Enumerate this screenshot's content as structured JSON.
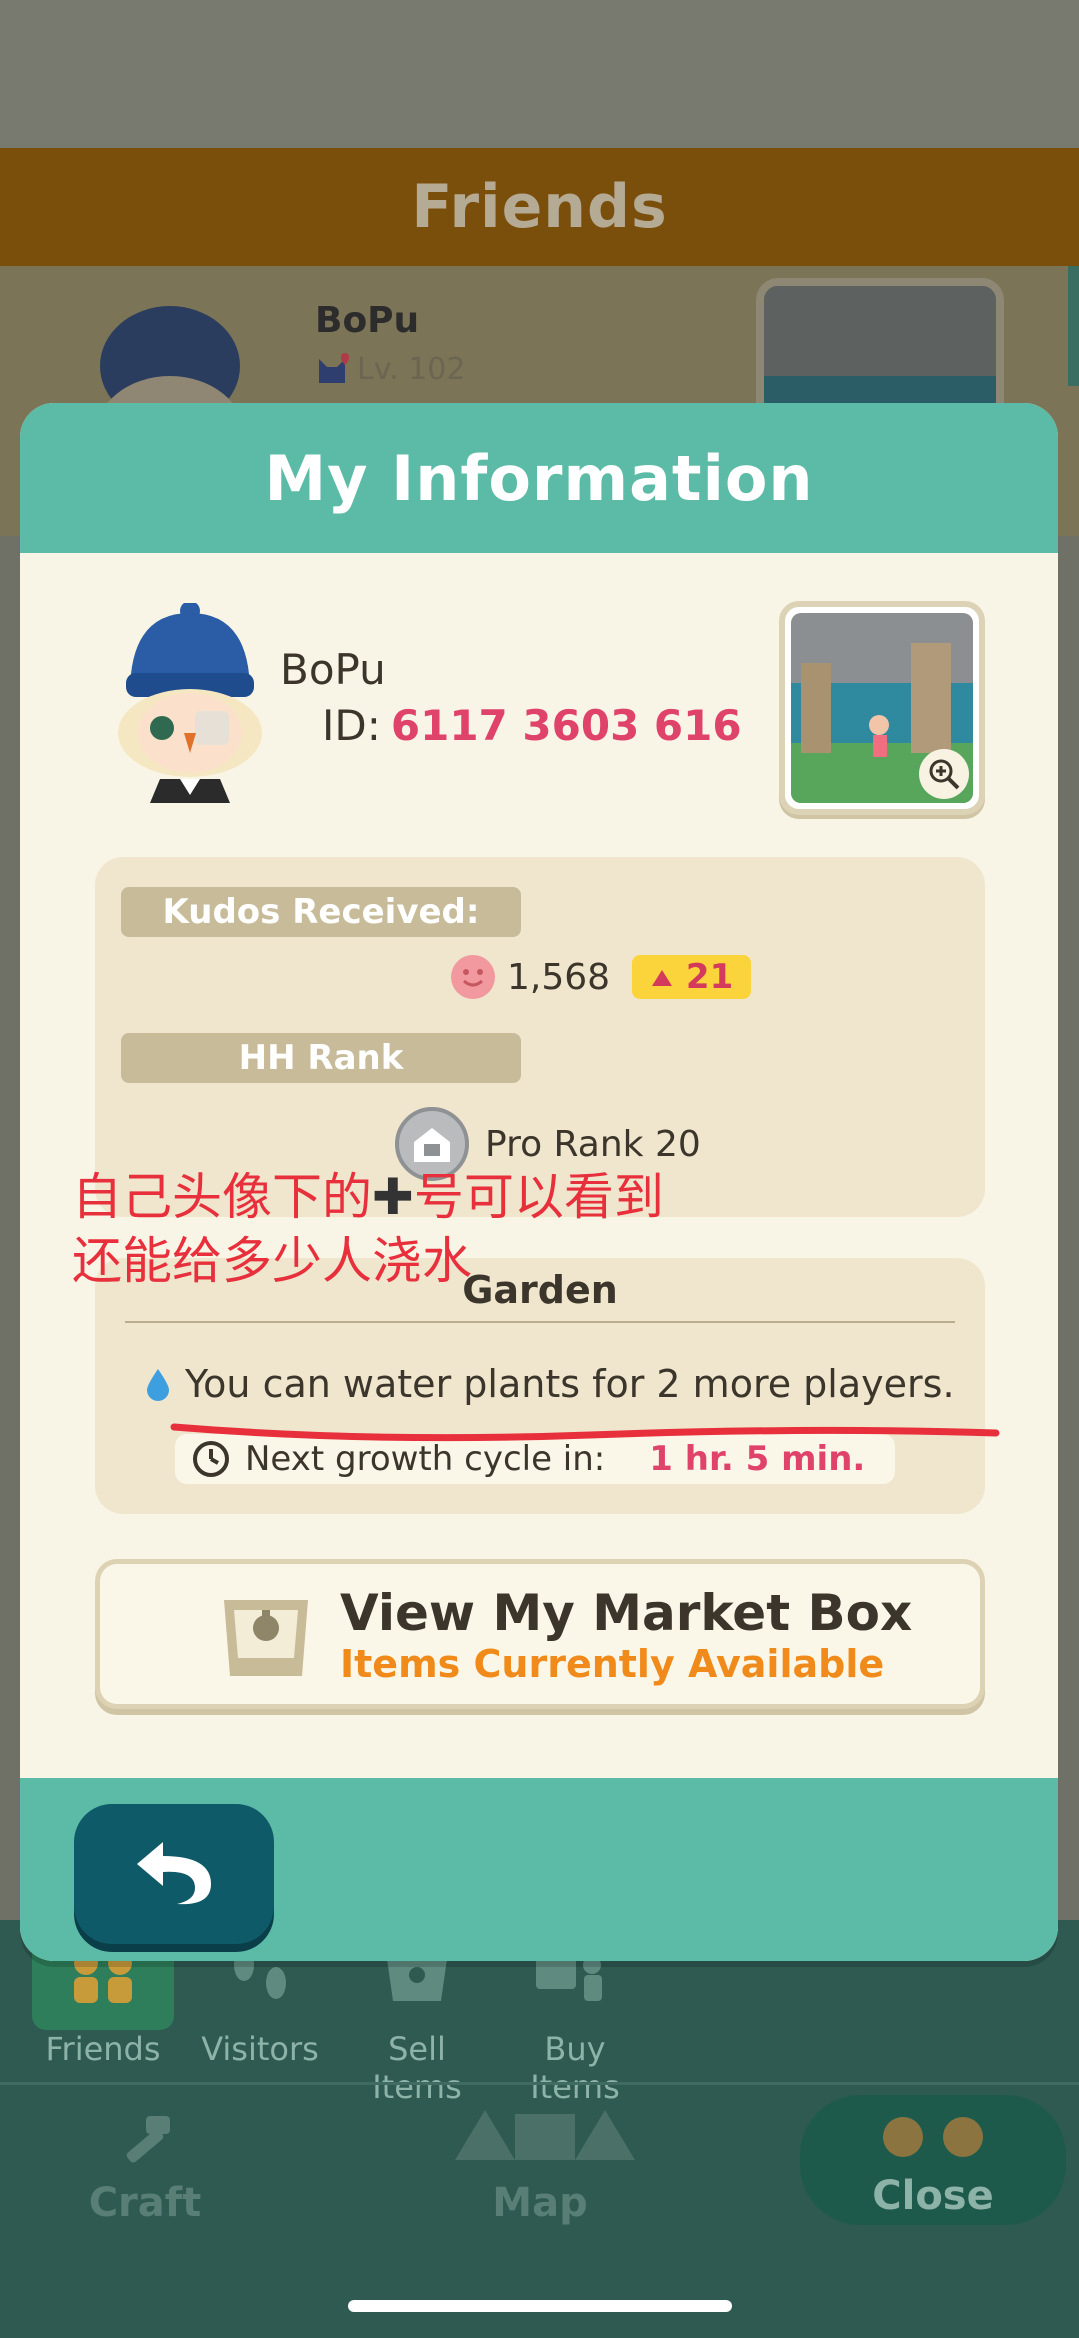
{
  "background_screen": {
    "title": "Friends",
    "friend": {
      "name": "BoPu",
      "level": "Lv. 102"
    },
    "tabs": [
      {
        "label": "Friends",
        "icon": "friends-icon"
      },
      {
        "label": "Visitors",
        "icon": "footprints-icon"
      },
      {
        "label": "Sell Items",
        "icon": "market-box-icon"
      },
      {
        "label": "Buy Items",
        "icon": "shopping-icon"
      }
    ],
    "nav": {
      "craft": "Craft",
      "map": "Map",
      "close": "Close"
    }
  },
  "modal": {
    "title": "My Information",
    "profile": {
      "name": "BoPu",
      "id_label": "ID:",
      "id_value": "6117 3603 616"
    },
    "kudos": {
      "label": "Kudos Received:",
      "value": "1,568",
      "increase": "21"
    },
    "rank": {
      "label": "HH Rank",
      "value": "Pro Rank 20"
    },
    "garden": {
      "title": "Garden",
      "water_message": "You can water plants for 2 more players.",
      "growth_label": "Next growth cycle in:",
      "growth_value": "1 hr. 5 min."
    },
    "market_box": {
      "title": "View My Market Box",
      "subtitle": "Items Currently Available"
    }
  },
  "annotation": {
    "text_before": "自己头像下的",
    "plus_symbol": "✚",
    "text_after": "号可以看到还能给多少人浇水",
    "color": "#e8303d"
  },
  "colors": {
    "header_teal": "#5bbba6",
    "accent_pink": "#e0436a",
    "accent_orange": "#f08b1b",
    "badge_yellow": "#fbd33b",
    "back_button": "#0e5a69"
  }
}
